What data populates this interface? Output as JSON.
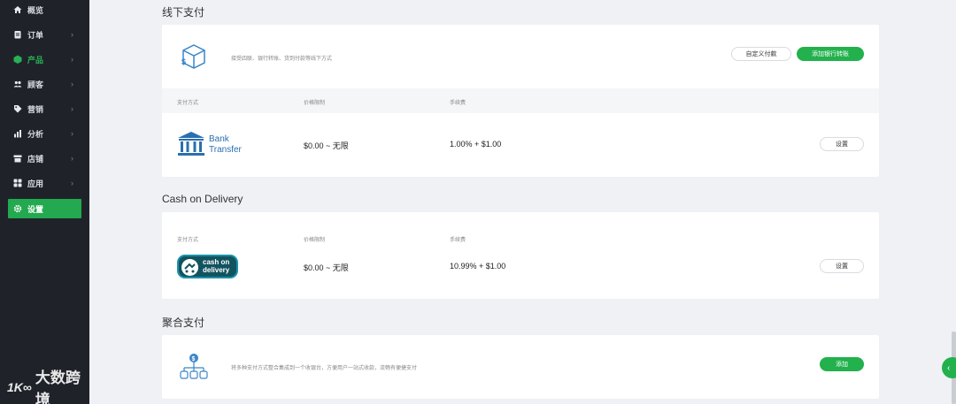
{
  "sidebar": {
    "items": [
      {
        "label": "概览",
        "icon": "home-icon",
        "has_chevron": false
      },
      {
        "label": "订单",
        "icon": "clipboard-icon",
        "has_chevron": true
      },
      {
        "label": "产品",
        "icon": "box-icon",
        "has_chevron": true
      },
      {
        "label": "顾客",
        "icon": "users-icon",
        "has_chevron": true
      },
      {
        "label": "营销",
        "icon": "tag-icon",
        "has_chevron": true
      },
      {
        "label": "分析",
        "icon": "bar-chart-icon",
        "has_chevron": true
      },
      {
        "label": "店铺",
        "icon": "store-icon",
        "has_chevron": true
      },
      {
        "label": "应用",
        "icon": "grid-icon",
        "has_chevron": true
      },
      {
        "label": "设置",
        "icon": "gear-icon",
        "has_chevron": false
      }
    ],
    "chevron": "›"
  },
  "offline": {
    "title": "线下支付",
    "description": "接受四联、银行转账、货到付款等线下方式",
    "custom_button": "自定义付款",
    "add_button": "添加银行转账",
    "columns": [
      "支付方式",
      "价格限制",
      "手续费"
    ],
    "row": {
      "method_line1": "Bank",
      "method_line2": "Transfer",
      "price_limit": "$0.00 ~ 无限",
      "fee": "1.00% + $1.00",
      "action": "设置"
    }
  },
  "cod": {
    "title": "Cash on Delivery",
    "columns": [
      "支付方式",
      "价格限制",
      "手续费"
    ],
    "row": {
      "method_line1": "cash on",
      "method_line2": "delivery",
      "price_limit": "$0.00 ~ 无限",
      "fee": "10.99% + $1.00",
      "action": "设置"
    }
  },
  "aggregate": {
    "title": "聚合支付",
    "description": "将多种支付方式整合集成到一个收银台，方便用户一站式收款，流畅有便捷支付",
    "add_button": "添加"
  },
  "watermark": {
    "logo": "1K∞",
    "text": "大数跨境"
  },
  "side_tab": {
    "glyph": "‹"
  },
  "colors": {
    "sidebar_bg": "#1f2329",
    "accent": "#22b14c",
    "page_bg": "#eff1f4",
    "icon_blue": "#2a6fb0"
  }
}
